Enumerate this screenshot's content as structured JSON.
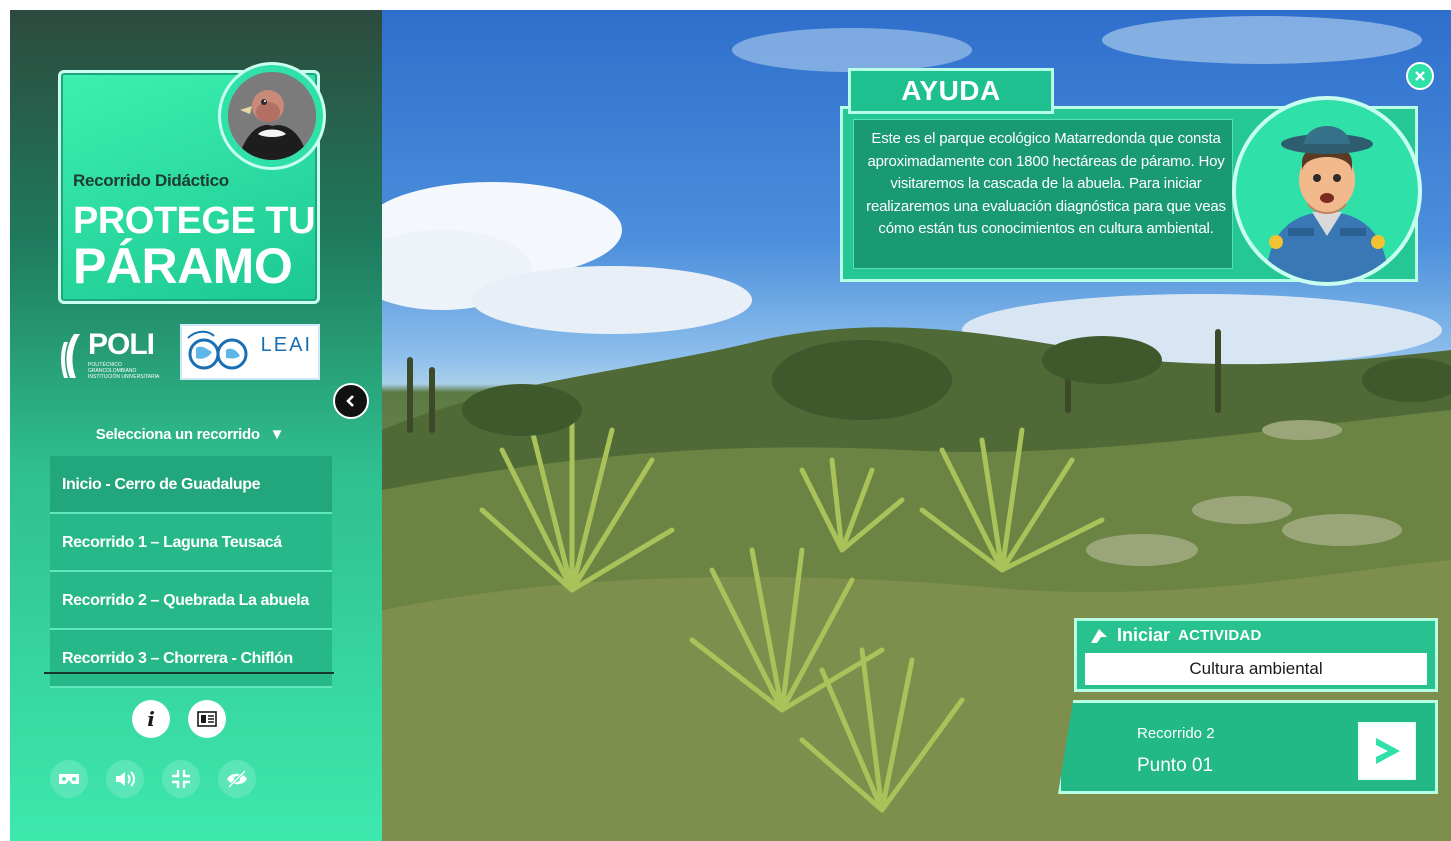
{
  "colors": {
    "accent": "#2fe0a8",
    "panel": "#25c894",
    "panel_dark": "#1a9a73",
    "sidebar_top": "#2d4a3e",
    "sidebar_bottom": "#3ee8ad"
  },
  "sidebar": {
    "title_sub": "Recorrido Didáctico",
    "title_line1": "PROTEGE TU",
    "title_line2": "PÁRAMO",
    "logo_poli": "POLI",
    "logo_poli_sub": "POLITÉCNICO GRANCOLOMBIANO INSTITUCIÓN UNIVERSITARIA",
    "logo_leai": "LEAI",
    "select_label": "Selecciona un recorrido",
    "routes": [
      {
        "label": "Inicio - Cerro de Guadalupe"
      },
      {
        "label": "Recorrido 1 – Laguna Teusacá"
      },
      {
        "label": "Recorrido 2 – Quebrada La abuela"
      },
      {
        "label": "Recorrido 3 – Chorrera - Chiflón"
      }
    ],
    "tools_top": [
      {
        "icon": "info-icon"
      },
      {
        "icon": "gallery-icon"
      }
    ],
    "tools_bottom": [
      {
        "icon": "vr-headset-icon"
      },
      {
        "icon": "volume-icon"
      },
      {
        "icon": "fullscreen-icon"
      },
      {
        "icon": "hide-icon"
      }
    ]
  },
  "help": {
    "tab_title": "AYUDA",
    "body": "Este es el parque ecológico Matarredonda que consta aproximadamente con 1800 hectáreas de páramo. Hoy visitaremos la cascada de la abuela. Para iniciar realizaremos una evaluación diagnóstica para que veas cómo están tus conocimientos en cultura ambiental."
  },
  "activity": {
    "start_label": "Iniciar",
    "activity_word": "ACTIVIDAD",
    "name": "Cultura ambiental"
  },
  "point": {
    "route": "Recorrido 2",
    "point": "Punto 01"
  }
}
